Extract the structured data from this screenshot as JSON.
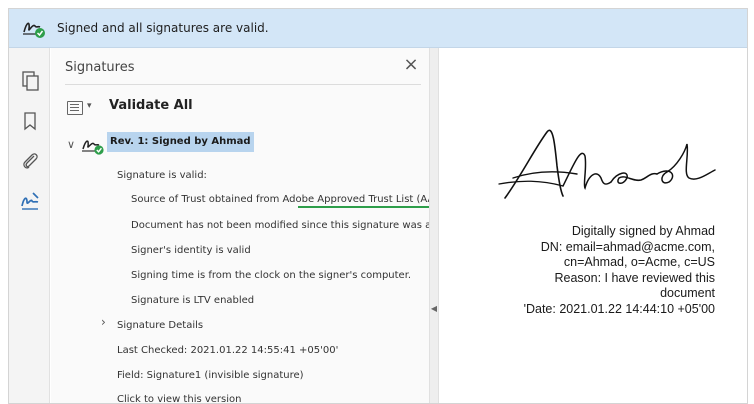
{
  "banner": {
    "text": "Signed and all signatures are valid."
  },
  "panel": {
    "title": "Signatures",
    "close": "×",
    "validate_all": "Validate All"
  },
  "revision": {
    "label": "Rev. 1: Signed by Ahmad",
    "validity": "Signature is valid:",
    "trust_prefix": "Source of Trust obtained from ",
    "trust_source": "Adobe Approved Trust List (AATL).",
    "not_modified": "Document has not been modified since this signature was applied",
    "identity": "Signer's identity is valid",
    "signing_time": "Signing time is from the clock on the signer's computer.",
    "ltv": "Signature is LTV enabled",
    "details": "Signature Details",
    "last_checked": "Last Checked: 2021.01.22 14:55:41 +05'00'",
    "field": "Field: Signature1 (invisible signature)",
    "view_version": "Click to view this version"
  },
  "document": {
    "stamp_lines": [
      "Digitally signed by Ahmad",
      "DN: email=ahmad@acme.com,",
      "cn=Ahmad, o=Acme, c=US",
      "Reason: I have reviewed this",
      "document",
      "'Date: 2021.01.22 14:44:10 +05'00"
    ]
  },
  "colors": {
    "banner_bg": "#d3e6f7",
    "selection": "#b8d4ee",
    "valid_green": "#2e9e4a",
    "rail_accent": "#2f6fb5"
  },
  "icons": {
    "banner": "signature-valid-icon",
    "rail": [
      "pages-icon",
      "bookmark-icon",
      "attachment-icon",
      "signature-panel-icon"
    ],
    "panel": [
      "options-list-icon",
      "close-icon"
    ]
  }
}
